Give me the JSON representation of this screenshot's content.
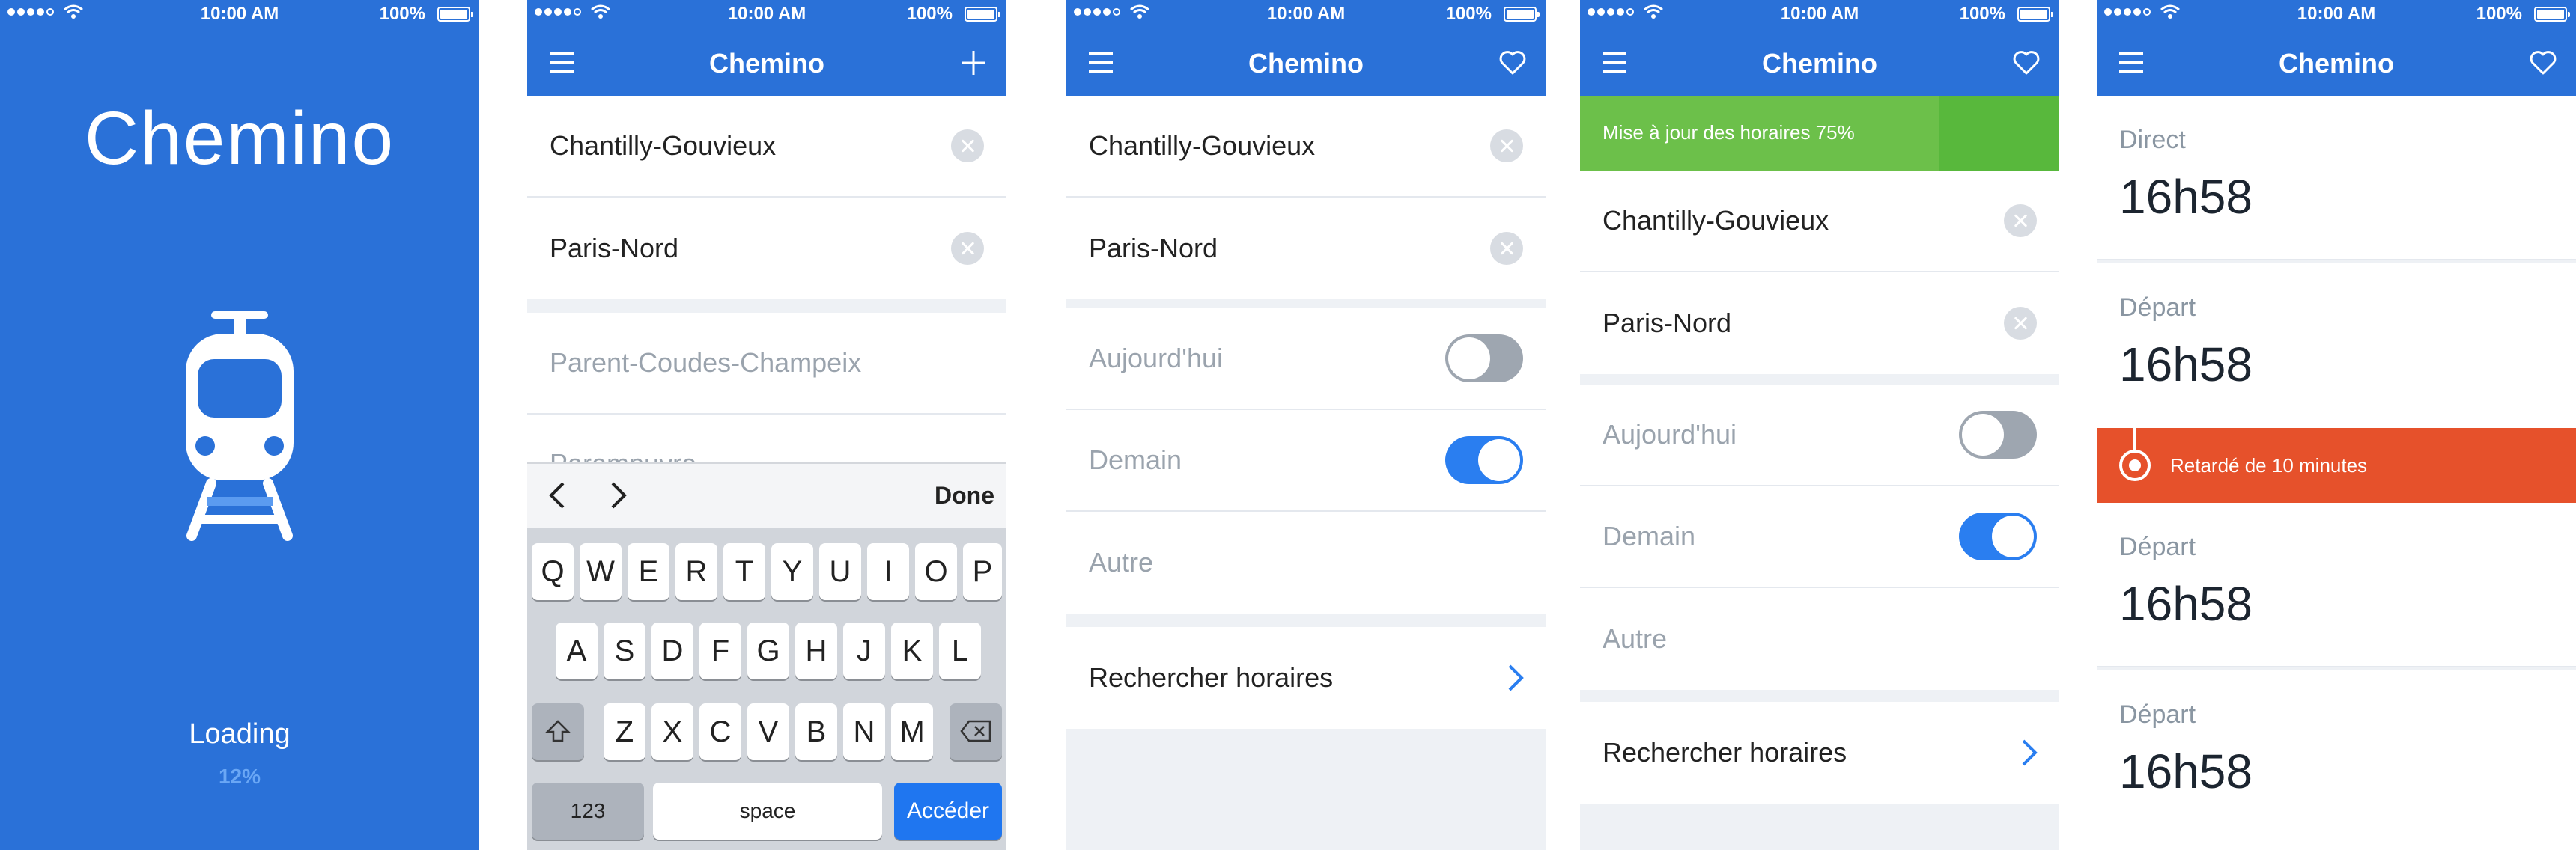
{
  "status": {
    "time": "10:00 AM",
    "battery": "100%"
  },
  "colors": {
    "brand": "#2a71d8",
    "progress": "#6cc04a",
    "alert": "#e6512b",
    "toggle_on": "#2a7ef0"
  },
  "splash": {
    "app_name": "Chemino",
    "loading_label": "Loading",
    "progress_text": "12%"
  },
  "app_title": "Chemino",
  "search_screen": {
    "from": "Chantilly-Gouvieux",
    "to": "Paris-Nord",
    "suggestions": [
      "Parent-Coudes-Champeix",
      "Parempuyre"
    ],
    "keyboard": {
      "done": "Done",
      "row1": [
        "Q",
        "W",
        "E",
        "R",
        "T",
        "Y",
        "U",
        "I",
        "O",
        "P"
      ],
      "row2": [
        "A",
        "S",
        "D",
        "F",
        "G",
        "H",
        "J",
        "K",
        "L"
      ],
      "row3": [
        "Z",
        "X",
        "C",
        "V",
        "B",
        "N",
        "M"
      ],
      "numbers": "123",
      "space": "space",
      "action": "Accéder"
    }
  },
  "options_screen": {
    "from": "Chantilly-Gouvieux",
    "to": "Paris-Nord",
    "today": "Aujourd'hui",
    "tomorrow": "Demain",
    "other": "Autre",
    "search": "Rechercher horaires",
    "today_on": false,
    "tomorrow_on": true
  },
  "update_screen": {
    "banner": "Mise à jour des horaires  75%",
    "banner_progress": 0.75
  },
  "results_screen": {
    "rows": [
      {
        "label": "Direct",
        "time": "16h58"
      },
      {
        "label": "Départ",
        "time": "16h58"
      },
      {
        "label": "Départ",
        "time": "16h58"
      },
      {
        "label": "Départ",
        "time": "16h58"
      }
    ],
    "alert": "Retardé de 10 minutes"
  },
  "icons": [
    "menu-icon",
    "plus-icon",
    "heart-icon",
    "train-icon",
    "chevron-left-icon",
    "chevron-right-icon",
    "shift-icon",
    "delete-icon",
    "wifi-icon",
    "battery-icon",
    "clear-icon",
    "delay-marker-icon"
  ]
}
